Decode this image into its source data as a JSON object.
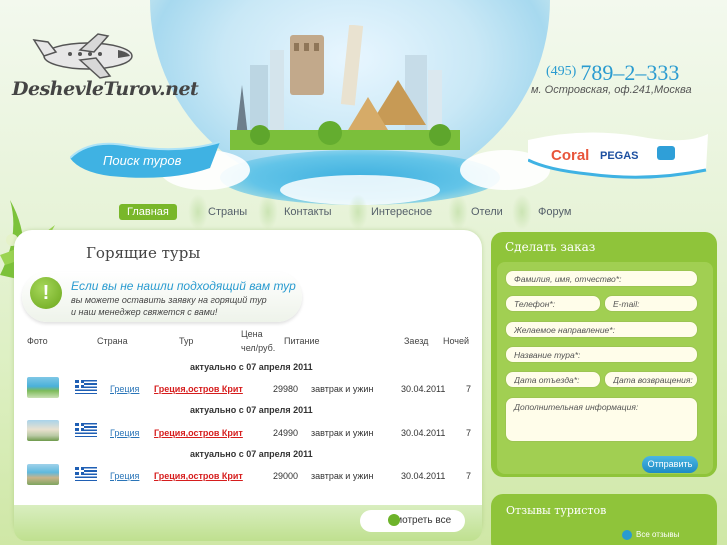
{
  "brand": {
    "logo_text": "DeshevleTurov.net"
  },
  "contact": {
    "phone_code": "(495)",
    "phone_number": "789–2–333",
    "address": "м. Островская, оф.241,Москва"
  },
  "search_banner": {
    "label": "Поиск туров"
  },
  "partners": {
    "coral": "Coral",
    "pegas": "PEGAS"
  },
  "nav": {
    "items": [
      "Главная",
      "Страны",
      "Контакты",
      "Интересное",
      "Отели",
      "Форум"
    ],
    "active": "Главная"
  },
  "content": {
    "title": "Горящие туры",
    "notice": {
      "title": "Если вы не нашли подходящий вам тур",
      "line1": "вы можете оставить заявку на горящий тур",
      "line2": "и наш менеджер свяжется с вами!"
    },
    "columns": {
      "photo": "Фото",
      "country": "Страна",
      "tour": "Тур",
      "price_line1": "Цена",
      "price_line2": "чел/руб.",
      "meal": "Питание",
      "arrival": "Заезд",
      "nights": "Ночей"
    },
    "rows": [
      {
        "note": "актуально с 07 апреля 2011",
        "country": "Греция",
        "tour": "Греция,остров Крит",
        "price": "29980",
        "meal": "завтрак и ужин",
        "date": "30.04.2011",
        "nights": "7"
      },
      {
        "note": "актуально с 07 апреля 2011",
        "country": "Греция",
        "tour": "Греция,остров Крит",
        "price": "24990",
        "meal": "завтрак и ужин",
        "date": "30.04.2011",
        "nights": "7"
      },
      {
        "note": "актуально с 07 апреля 2011",
        "country": "Греция",
        "tour": "Греция,остров Крит",
        "price": "29000",
        "meal": "завтрак и ужин",
        "date": "30.04.2011",
        "nights": "7"
      }
    ],
    "see_all": "Смотреть все"
  },
  "order": {
    "title": "Сделать заказ",
    "fields": {
      "name": "Фамилия, имя, отчество*:",
      "phone": "Телефон*:",
      "email": "E-mail:",
      "direction": "Желаемое направление*:",
      "tour_name": "Название тура*:",
      "departure": "Дата отъезда*:",
      "return": "Дата возвращения:",
      "info": "Дополнительная информация:"
    },
    "submit": "Отправить"
  },
  "reviews": {
    "title": "Отзывы туристов",
    "all": "Все отзывы"
  },
  "colors": {
    "accent_green": "#8fc43a",
    "accent_blue": "#2a9bd0",
    "link_red": "#d61d1d"
  }
}
